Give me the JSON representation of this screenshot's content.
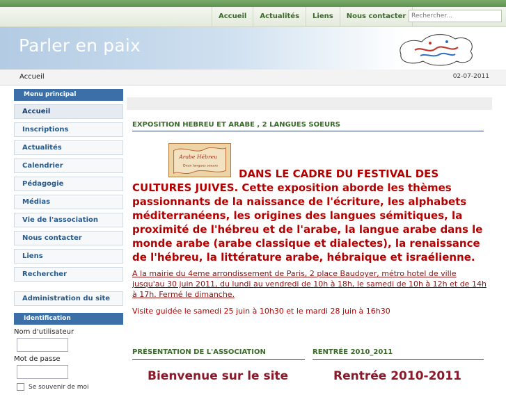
{
  "topnav": {
    "links": [
      "Accueil",
      "Actualités",
      "Liens",
      "Nous contacter"
    ],
    "search_placeholder": "Rechercher..."
  },
  "site": {
    "title": "Parler en paix"
  },
  "breadcrumb": {
    "current": "Accueil",
    "date": "02-07-2011"
  },
  "sidebar": {
    "menu_title": "Menu principal",
    "items": [
      "Accueil",
      "Inscriptions",
      "Actualités",
      "Calendrier",
      "Pédagogie",
      "Médias",
      "Vie de l'association",
      "Nous contacter",
      "Liens",
      "Rechercher"
    ],
    "admin": "Administration du site",
    "ident_title": "Identification",
    "username_label": "Nom d'utilisateur",
    "password_label": "Mot de passe",
    "remember_label": "Se souvenir de moi"
  },
  "article": {
    "title": "EXPOSITION HEBREU ET ARABE , 2 LANGUES SOEURS",
    "image_caption": "Arabe Hébreu",
    "image_subcaption": "Deux langues soeurs",
    "body": "DANS LE CADRE DU FESTIVAL DES CULTURES JUIVES. Cette exposition aborde les thèmes passionnants de la naissance de l'écriture, les alphabets méditerranéens, les origines des langues sémitiques, la proximité de l'hébreu et de l'arabe, la langue arabe dans le monde arabe (arabe classique et dialectes), la renaissance de l'hébreu, la littérature arabe, hébraique et israélienne.",
    "link": "A la mairie du 4eme arrondissement de Paris, 2 place Baudoyer, métro hotel de ville jusqu'au 30 juin 2011, du lundi au vendredi de 10h à 18h, le samedi de 10h à 12h et de 14h à 17h. Fermé le dimanche.",
    "visit": "Visite guidée le samedi 25 juin à 10h30 et le mardi 28 juin à 16h30"
  },
  "columns": [
    {
      "title": "PRÉSENTATION DE L'ASSOCIATION",
      "heading": "Bienvenue sur le site"
    },
    {
      "title": "RENTRÉE 2010_2011",
      "heading": "Rentrée 2010-2011"
    }
  ],
  "colors": {
    "green": "#3a6a2a",
    "blue": "#3c6fa8",
    "red": "#b50000"
  }
}
